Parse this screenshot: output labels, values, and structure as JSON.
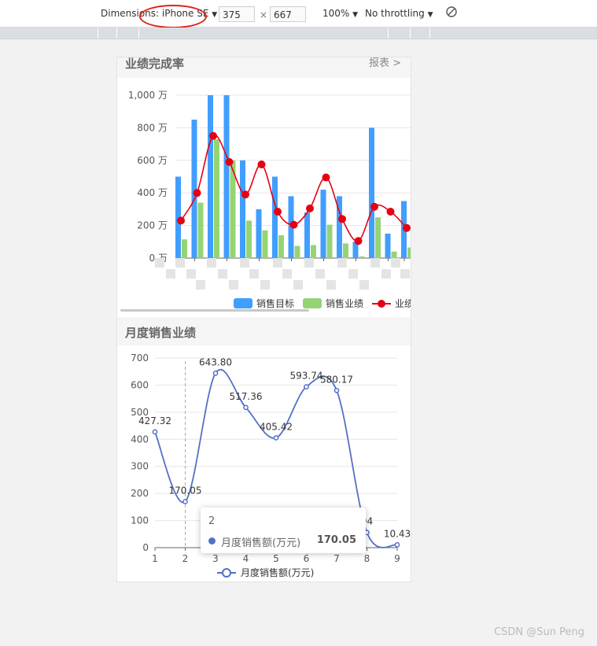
{
  "devtools": {
    "dimensions_label": "Dimensions: iPhone SE",
    "width": "375",
    "height": "667",
    "times": "×",
    "zoom": "100%",
    "throttling": "No throttling",
    "rotate_icon": "rotate-icon",
    "highlight_color": "#e0201a"
  },
  "section1": {
    "title": "业绩完成率",
    "link": "报表 >"
  },
  "section2": {
    "title": "月度销售业绩"
  },
  "chart_data": [
    {
      "type": "bar",
      "categories": [
        "",
        "",
        "",
        "",
        "",
        "",
        "",
        "",
        "",
        "",
        "",
        "",
        "",
        "",
        ""
      ],
      "yticks": [
        "0 万",
        "200 万",
        "400 万",
        "600 万",
        "800 万",
        "1,000 万"
      ],
      "ylim": [
        0,
        1000
      ],
      "series": [
        {
          "name": "销售目标",
          "color": "#409eff",
          "values": [
            500,
            850,
            1000,
            1000,
            600,
            300,
            500,
            380,
            280,
            420,
            380,
            100,
            800,
            150,
            350
          ]
        },
        {
          "name": "销售业绩",
          "color": "#95d475",
          "values": [
            115,
            340,
            730,
            600,
            230,
            170,
            140,
            75,
            80,
            205,
            90,
            10,
            250,
            40,
            65
          ]
        },
        {
          "name": "业绩",
          "color": "#e60012",
          "values": [
            230,
            400,
            750,
            590,
            390,
            575,
            285,
            205,
            305,
            495,
            240,
            105,
            315,
            285,
            185
          ]
        }
      ],
      "legend_position": "bottom-right",
      "grid": true
    },
    {
      "type": "line",
      "x": [
        1,
        2,
        3,
        4,
        5,
        6,
        7,
        8,
        9
      ],
      "yticks": [
        0,
        100,
        200,
        300,
        400,
        500,
        600,
        700
      ],
      "ylim": [
        0,
        700
      ],
      "series": [
        {
          "name": "月度销售额(万元)",
          "color": "#5470c6",
          "values": [
            427.32,
            170.05,
            643.8,
            517.36,
            405.42,
            593.74,
            580.17,
            55.94,
            10.43
          ]
        }
      ],
      "labels": [
        "427.32",
        "170.05",
        "643.80",
        "517.36",
        "405.42",
        "593.74",
        "580.17",
        "94",
        "10.43"
      ],
      "legend_position": "bottom-center",
      "grid": true,
      "tooltip": {
        "title": "2",
        "name": "月度销售额(万元)",
        "value": "170.05"
      }
    }
  ],
  "watermark": "CSDN @Sun  Peng"
}
